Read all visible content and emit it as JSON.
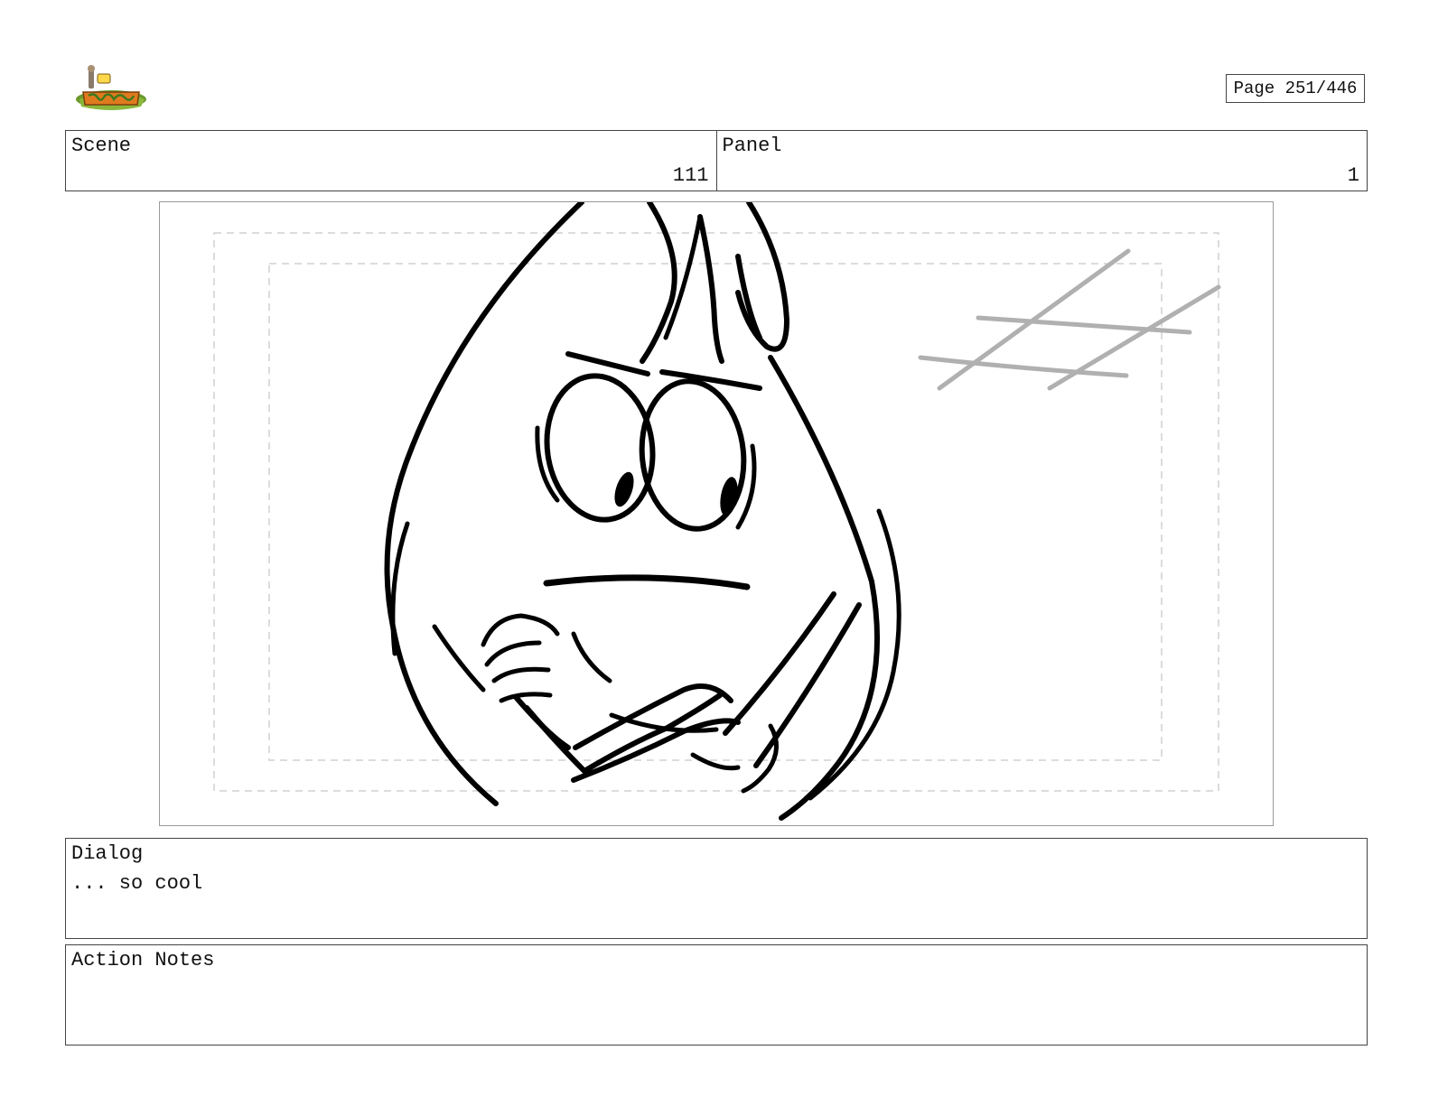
{
  "header": {
    "page_label": "Page 251/446"
  },
  "scene": {
    "label": "Scene",
    "value": "111"
  },
  "panel": {
    "label": "Panel",
    "value": "1"
  },
  "dialog": {
    "label": "Dialog",
    "text": "... so cool"
  },
  "action_notes": {
    "label": "Action Notes",
    "text": ""
  },
  "colors": {
    "logo_grass": "#6a9a2e",
    "logo_orange": "#e07a1f",
    "sketch_line": "#000000",
    "window_line": "#b0b0b0",
    "safe_area_line": "#d0d0d0"
  }
}
